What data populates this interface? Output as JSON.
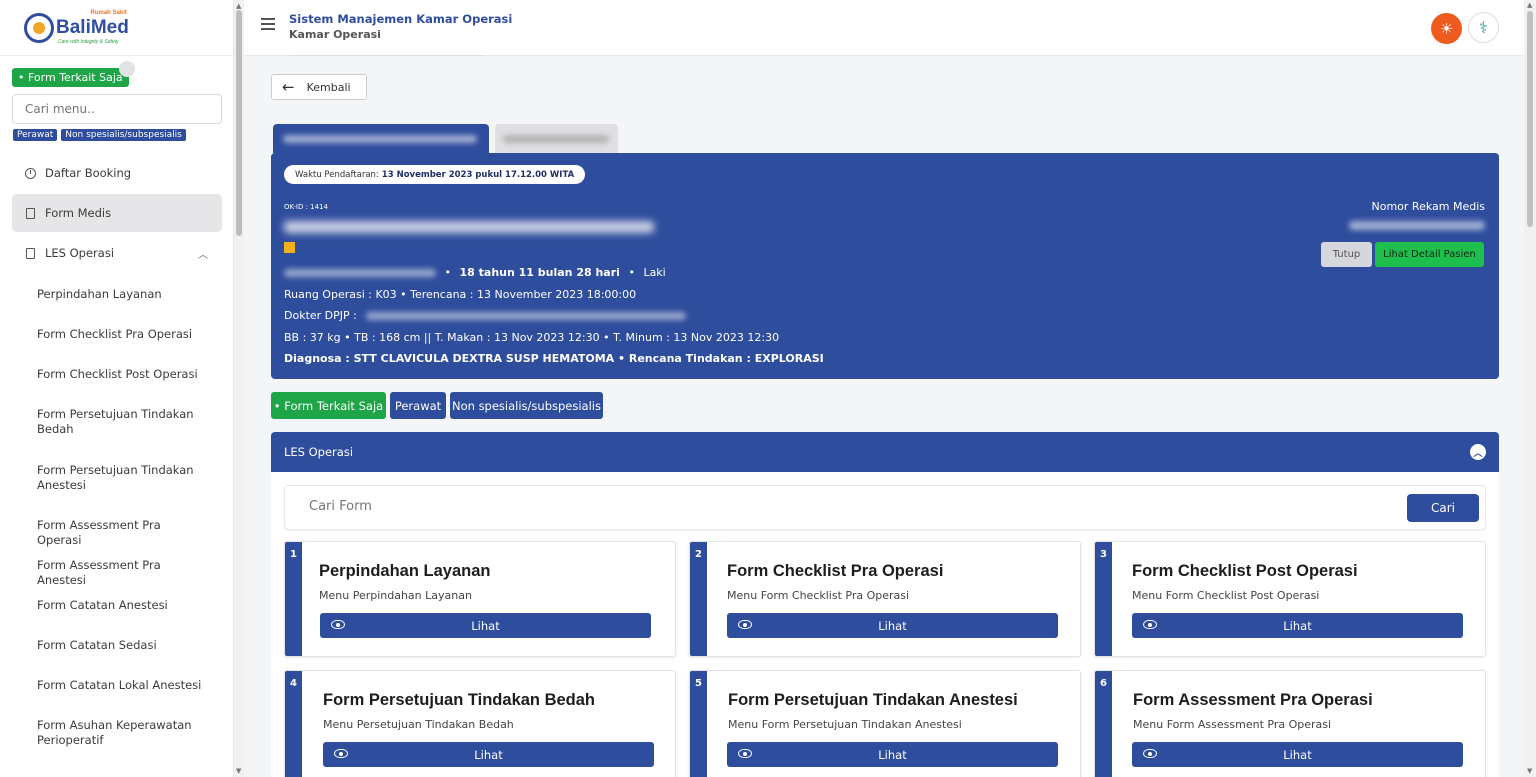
{
  "brand": {
    "name": "BaliMed",
    "top_tag": "Rumah Sakit",
    "tagline": "Care with Integrity & Safety"
  },
  "sidebar": {
    "filter_chip": "• Form Terkait Saja",
    "search_placeholder": "Cari menu..",
    "tags": [
      "Perawat",
      "Non spesialis/subspesialis"
    ],
    "items": [
      {
        "label": "Daftar Booking",
        "icon": "clock-icon"
      },
      {
        "label": "Form Medis",
        "icon": "document-icon"
      },
      {
        "label": "LES Operasi",
        "icon": "document-icon"
      }
    ],
    "sub_items": [
      "Perpindahan Layanan",
      "Form Checklist Pra Operasi",
      "Form Checklist Post Operasi",
      "Form Persetujuan Tindakan Bedah",
      "Form Persetujuan Tindakan Anestesi",
      "Form Assessment Pra Operasi",
      "Form Assessment Pra Anestesi",
      "Form Catatan Anestesi",
      "Form Catatan Sedasi",
      "Form Catatan Lokal Anestesi",
      "Form Asuhan Keperawatan Perioperatif"
    ]
  },
  "header": {
    "title": "Sistem Manajemen Kamar Operasi",
    "subtitle": "Kamar Operasi"
  },
  "back_label": "Kembali",
  "patient": {
    "reg_label": "Waktu Pendaftaran:",
    "reg_value": "13 November 2023 pukul 17.12.00 WITA",
    "ok_id": "OK-ID : 1414",
    "age_sex_sep": "•",
    "age": "18 tahun 11 bulan 28 hari",
    "sex": "Laki",
    "ruang": "Ruang Operasi : K03 • Terencana : 13 November 2023 18:00:00",
    "dokter_label": "Dokter DPJP :",
    "vitals": "BB : 37 kg • TB : 168 cm || T. Makan : 13 Nov 2023 12:30 • T. Minum : 13 Nov 2023 12:30",
    "diagnosa": "Diagnosa : STT CLAVICULA DEXTRA SUSP HEMATOMA  •  Rencana Tindakan : EXPLORASI",
    "nrm_label": "Nomor Rekam Medis",
    "btn_close": "Tutup",
    "btn_detail": "Lihat Detail Pasien"
  },
  "filters": {
    "related": "• Form Terkait Saja",
    "role": "Perawat",
    "level": "Non spesialis/subspesialis"
  },
  "section": {
    "title": "LES Operasi",
    "search_placeholder": "Cari Form",
    "search_button": "Cari"
  },
  "forms": [
    {
      "num": "1",
      "title": "Perpindahan Layanan",
      "desc": "Menu Perpindahan Layanan",
      "button": "Lihat"
    },
    {
      "num": "2",
      "title": "Form Checklist Pra Operasi",
      "desc": "Menu Form Checklist Pra Operasi",
      "button": "Lihat"
    },
    {
      "num": "3",
      "title": "Form Checklist Post Operasi",
      "desc": "Menu Form Checklist Post Operasi",
      "button": "Lihat"
    },
    {
      "num": "4",
      "title": "Form Persetujuan Tindakan Bedah",
      "desc": "Menu Persetujuan Tindakan Bedah",
      "button": "Lihat"
    },
    {
      "num": "5",
      "title": "Form Persetujuan Tindakan Anestesi",
      "desc": "Menu Form Persetujuan Tindakan Anestesi",
      "button": "Lihat"
    },
    {
      "num": "6",
      "title": "Form Assessment Pra Operasi",
      "desc": "Menu Form Assessment Pra Operasi",
      "button": "Lihat"
    }
  ],
  "colors": {
    "primary": "#2f4d9d",
    "success": "#1ea547",
    "accent": "#ef5a1e"
  }
}
